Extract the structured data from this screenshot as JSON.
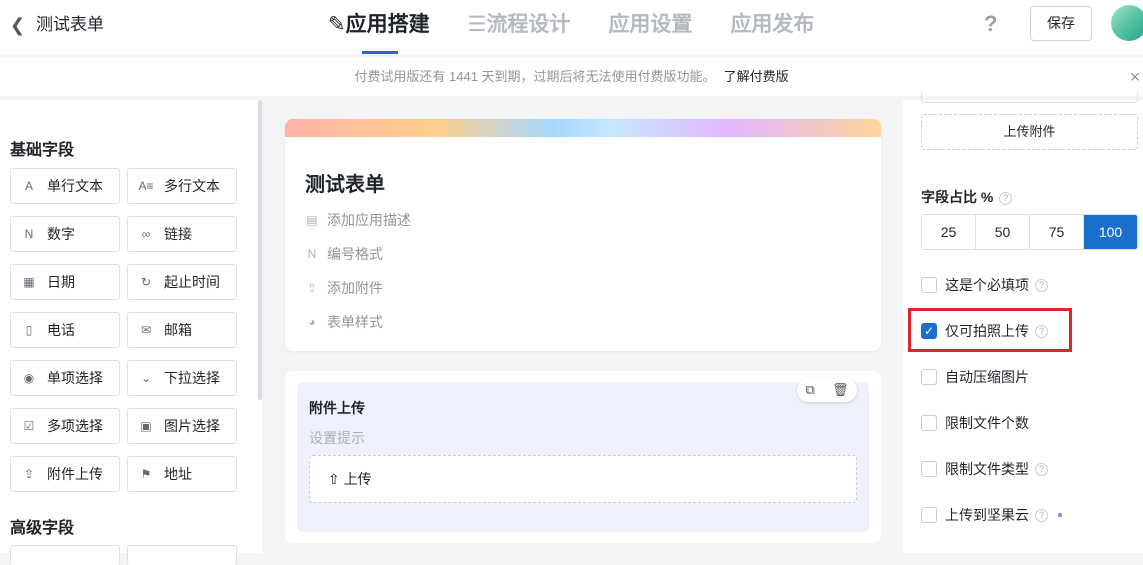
{
  "header": {
    "back_icon": "chevron-left-icon",
    "app_title": "测试表单",
    "tabs": [
      {
        "label": "应用搭建",
        "icon": "edit-icon",
        "active": true
      },
      {
        "label": "流程设计",
        "icon": "flow-icon",
        "active": false
      },
      {
        "label": "应用设置",
        "active": false
      },
      {
        "label": "应用发布",
        "active": false
      }
    ],
    "help_label": "?",
    "save_label": "保存"
  },
  "notice": {
    "text": "付费试用版还有 1441 天到期，过期后将无法使用付费版功能。",
    "link": "了解付费版",
    "close": "×"
  },
  "sidebar": {
    "basic_title": "基础字段",
    "advanced_title": "高级字段",
    "fields": [
      {
        "label": "单行文本",
        "icon": "A"
      },
      {
        "label": "多行文本",
        "icon": "A≡"
      },
      {
        "label": "数字",
        "icon": "N"
      },
      {
        "label": "链接",
        "icon": "∞"
      },
      {
        "label": "日期",
        "icon": "▦"
      },
      {
        "label": "起止时间",
        "icon": "↻"
      },
      {
        "label": "电话",
        "icon": "▯"
      },
      {
        "label": "邮箱",
        "icon": "✉"
      },
      {
        "label": "单项选择",
        "icon": "◉"
      },
      {
        "label": "下拉选择",
        "icon": "⌄"
      },
      {
        "label": "多项选择",
        "icon": "☑"
      },
      {
        "label": "图片选择",
        "icon": "▣"
      },
      {
        "label": "附件上传",
        "icon": "⇪"
      },
      {
        "label": "地址",
        "icon": "⚑"
      }
    ]
  },
  "form": {
    "title": "测试表单",
    "meta": [
      {
        "label": "添加应用描述",
        "icon": "comment-icon"
      },
      {
        "label": "编号格式",
        "icon": "number-icon"
      },
      {
        "label": "添加附件",
        "icon": "upload-icon"
      },
      {
        "label": "表单样式",
        "icon": "palette-icon"
      }
    ],
    "attachment": {
      "title": "附件上传",
      "hint": "设置提示",
      "upload_label": "上传"
    }
  },
  "props": {
    "upload_attachment_label": "上传附件",
    "ratio_label": "字段占比 %",
    "ratios": [
      "25",
      "50",
      "75",
      "100"
    ],
    "selected_ratio": "100",
    "options": [
      {
        "label": "这是个必填项",
        "checked": false,
        "help": true
      },
      {
        "label": "仅可拍照上传",
        "checked": true,
        "help": true
      },
      {
        "label": "自动压缩图片",
        "checked": false,
        "help": false
      },
      {
        "label": "限制文件个数",
        "checked": false,
        "help": false
      },
      {
        "label": "限制文件类型",
        "checked": false,
        "help": true
      },
      {
        "label": "上传到坚果云",
        "checked": false,
        "help": true
      }
    ]
  },
  "colors": {
    "accent": "#1a6fce",
    "highlight": "#e0242b"
  }
}
